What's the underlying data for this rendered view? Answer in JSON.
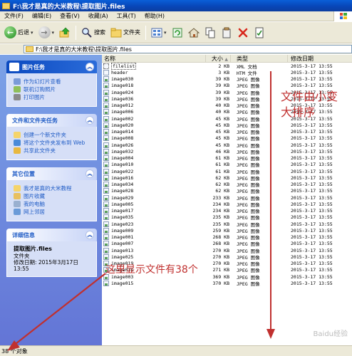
{
  "window": {
    "title": "F:\\我才是真的大米教程\\提取图片.files"
  },
  "menu": [
    "文件(F)",
    "编辑(E)",
    "查看(V)",
    "收藏(A)",
    "工具(T)",
    "帮助(H)"
  ],
  "toolbar": {
    "back_label": "后退",
    "search_label": "搜索",
    "folders_label": "文件夹"
  },
  "address": {
    "value": "F:\\我才是真的大米教程\\提取图片.files"
  },
  "left_panels": {
    "picture_tasks": {
      "title": "图片任务",
      "items": [
        "作为幻灯片查看",
        "联机订购照片",
        "打印图片"
      ]
    },
    "file_tasks": {
      "title": "文件和文件夹任务",
      "items": [
        "创建一个新文件夹",
        "将这个文件夹发布到 Web",
        "共享此文件夹"
      ]
    },
    "other_places": {
      "title": "其它位置",
      "items": [
        "我才是真的大米教程",
        "图片收藏",
        "我的电脑",
        "网上邻居"
      ]
    },
    "details": {
      "title": "详细信息",
      "name": "提取图片.files",
      "kind": "文件夹",
      "modified_label": "修改日期: 2015年3月17日",
      "modified_time": "13:55"
    }
  },
  "columns": {
    "name": "名称",
    "size": "大小",
    "sort_arrow": "▲",
    "type": "类型",
    "date": "修改日期"
  },
  "files": [
    {
      "name": "filelist",
      "size": "2 KB",
      "type": "XML 文档",
      "date": "2015-3-17 13:55",
      "icon": "xml"
    },
    {
      "name": "header",
      "size": "3 KB",
      "type": "HTM 文件",
      "date": "2015-3-17 13:55",
      "icon": "htm"
    },
    {
      "name": "image030",
      "size": "39 KB",
      "type": "JPEG 图像",
      "date": "2015-3-17 13:55",
      "icon": "img"
    },
    {
      "name": "image018",
      "size": "39 KB",
      "type": "JPEG 图像",
      "date": "2015-3-17 13:55",
      "icon": "img"
    },
    {
      "name": "image024",
      "size": "39 KB",
      "type": "JPEG 图像",
      "date": "2015-3-17 13:55",
      "icon": "img"
    },
    {
      "name": "image036",
      "size": "39 KB",
      "type": "JPEG 图像",
      "date": "2015-3-17 13:55",
      "icon": "img"
    },
    {
      "name": "image012",
      "size": "40 KB",
      "type": "JPEG 图像",
      "date": "2015-3-17 13:55",
      "icon": "img"
    },
    {
      "name": "image006",
      "size": "40 KB",
      "type": "JPEG 图像",
      "date": "2015-3-17 13:55",
      "icon": "img"
    },
    {
      "name": "image002",
      "size": "45 KB",
      "type": "JPEG 图像",
      "date": "2015-3-17 13:55",
      "icon": "img"
    },
    {
      "name": "image020",
      "size": "45 KB",
      "type": "JPEG 图像",
      "date": "2015-3-17 13:55",
      "icon": "img"
    },
    {
      "name": "image014",
      "size": "45 KB",
      "type": "JPEG 图像",
      "date": "2015-3-17 13:55",
      "icon": "img"
    },
    {
      "name": "image008",
      "size": "45 KB",
      "type": "JPEG 图像",
      "date": "2015-3-17 13:55",
      "icon": "img"
    },
    {
      "name": "image026",
      "size": "45 KB",
      "type": "JPEG 图像",
      "date": "2015-3-17 13:55",
      "icon": "img"
    },
    {
      "name": "image032",
      "size": "46 KB",
      "type": "JPEG 图像",
      "date": "2015-3-17 13:55",
      "icon": "img"
    },
    {
      "name": "image004",
      "size": "61 KB",
      "type": "JPEG 图像",
      "date": "2015-3-17 13:55",
      "icon": "img"
    },
    {
      "name": "image010",
      "size": "61 KB",
      "type": "JPEG 图像",
      "date": "2015-3-17 13:55",
      "icon": "img"
    },
    {
      "name": "image022",
      "size": "61 KB",
      "type": "JPEG 图像",
      "date": "2015-3-17 13:55",
      "icon": "img"
    },
    {
      "name": "image016",
      "size": "62 KB",
      "type": "JPEG 图像",
      "date": "2015-3-17 13:55",
      "icon": "img"
    },
    {
      "name": "image034",
      "size": "62 KB",
      "type": "JPEG 图像",
      "date": "2015-3-17 13:55",
      "icon": "img"
    },
    {
      "name": "image028",
      "size": "62 KB",
      "type": "JPEG 图像",
      "date": "2015-3-17 13:55",
      "icon": "img"
    },
    {
      "name": "image029",
      "size": "233 KB",
      "type": "JPEG 图像",
      "date": "2015-3-17 13:55",
      "icon": "img"
    },
    {
      "name": "image005",
      "size": "234 KB",
      "type": "JPEG 图像",
      "date": "2015-3-17 13:55",
      "icon": "img"
    },
    {
      "name": "image017",
      "size": "234 KB",
      "type": "JPEG 图像",
      "date": "2015-3-17 13:55",
      "icon": "img"
    },
    {
      "name": "image035",
      "size": "235 KB",
      "type": "JPEG 图像",
      "date": "2015-3-17 13:55",
      "icon": "img"
    },
    {
      "name": "image023",
      "size": "235 KB",
      "type": "JPEG 图像",
      "date": "2015-3-17 13:55",
      "icon": "img"
    },
    {
      "name": "image009",
      "size": "259 KB",
      "type": "JPEG 图像",
      "date": "2015-3-17 13:55",
      "icon": "img"
    },
    {
      "name": "image001",
      "size": "268 KB",
      "type": "JPEG 图像",
      "date": "2015-3-17 13:55",
      "icon": "img"
    },
    {
      "name": "image007",
      "size": "268 KB",
      "type": "JPEG 图像",
      "date": "2015-3-17 13:55",
      "icon": "img"
    },
    {
      "name": "image013",
      "size": "270 KB",
      "type": "JPEG 图像",
      "date": "2015-3-17 13:55",
      "icon": "img"
    },
    {
      "name": "image025",
      "size": "270 KB",
      "type": "JPEG 图像",
      "date": "2015-3-17 13:55",
      "icon": "img"
    },
    {
      "name": "image019",
      "size": "270 KB",
      "type": "JPEG 图像",
      "date": "2015-3-17 13:55",
      "icon": "img"
    },
    {
      "name": "image031",
      "size": "271 KB",
      "type": "JPEG 图像",
      "date": "2015-3-17 13:55",
      "icon": "img"
    },
    {
      "name": "image003",
      "size": "369 KB",
      "type": "JPEG 图像",
      "date": "2015-3-17 13:55",
      "icon": "img"
    },
    {
      "name": "image015",
      "size": "370 KB",
      "type": "JPEG 图像",
      "date": "2015-3-17 13:55",
      "icon": "img"
    }
  ],
  "status": {
    "text": "38 个对象"
  },
  "annotations": {
    "sort_note": "文件由小变大排序",
    "count_note": "这里显示文件有38个"
  },
  "watermark": "Baidu经验",
  "colors": {
    "annotation": "#c0302f",
    "titlebar": "#0a5fd8",
    "sidebar": "#7ba2e7"
  }
}
